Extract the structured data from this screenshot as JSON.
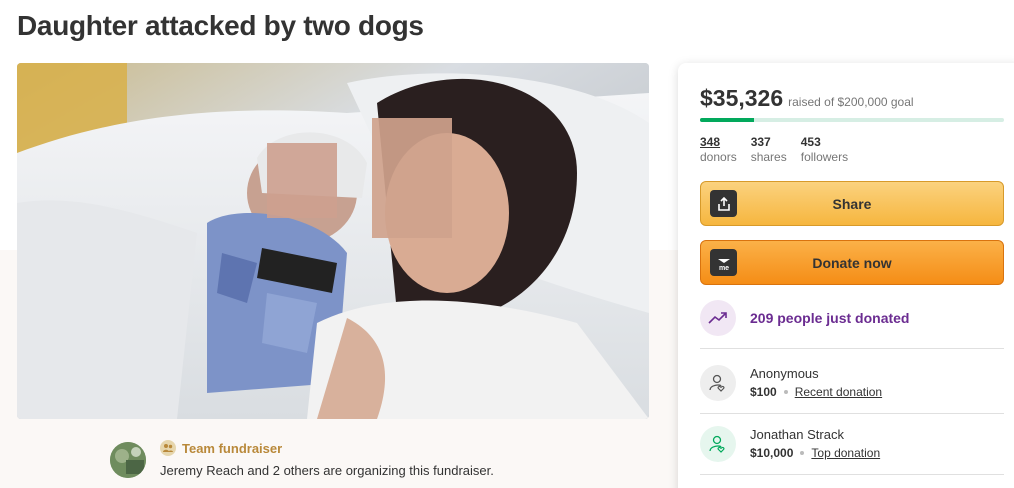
{
  "page": {
    "title": "Daughter attacked by two dogs"
  },
  "organizer": {
    "team_label": "Team fundraiser",
    "text": "Jeremy Reach and 2 others are organizing this fundraiser."
  },
  "donation_card": {
    "raised_amount": "$35,326",
    "raised_text": "raised of $200,000 goal",
    "progress_fraction": 0.177,
    "stats": [
      {
        "value": "348",
        "label": "donors"
      },
      {
        "value": "337",
        "label": "shares"
      },
      {
        "value": "453",
        "label": "followers"
      }
    ],
    "share_label": "Share",
    "donate_label": "Donate now",
    "trend_text": "209 people just donated",
    "donations": [
      {
        "name": "Anonymous",
        "amount": "$100",
        "tag": "Recent donation"
      },
      {
        "name": "Jonathan Strack",
        "amount": "$10,000",
        "tag": "Top donation"
      }
    ]
  },
  "colors": {
    "accent_green": "#02a95c",
    "share_button": "#f6b63f",
    "donate_button": "#f58d16",
    "trend_purple": "#6b2c91",
    "team_gold": "#b9893a"
  },
  "icons": {
    "share": "share-upload-icon",
    "donate": "gofundme-logo-icon",
    "trend": "trending-up-icon",
    "donor": "user-heart-icon",
    "team": "team-icon"
  }
}
